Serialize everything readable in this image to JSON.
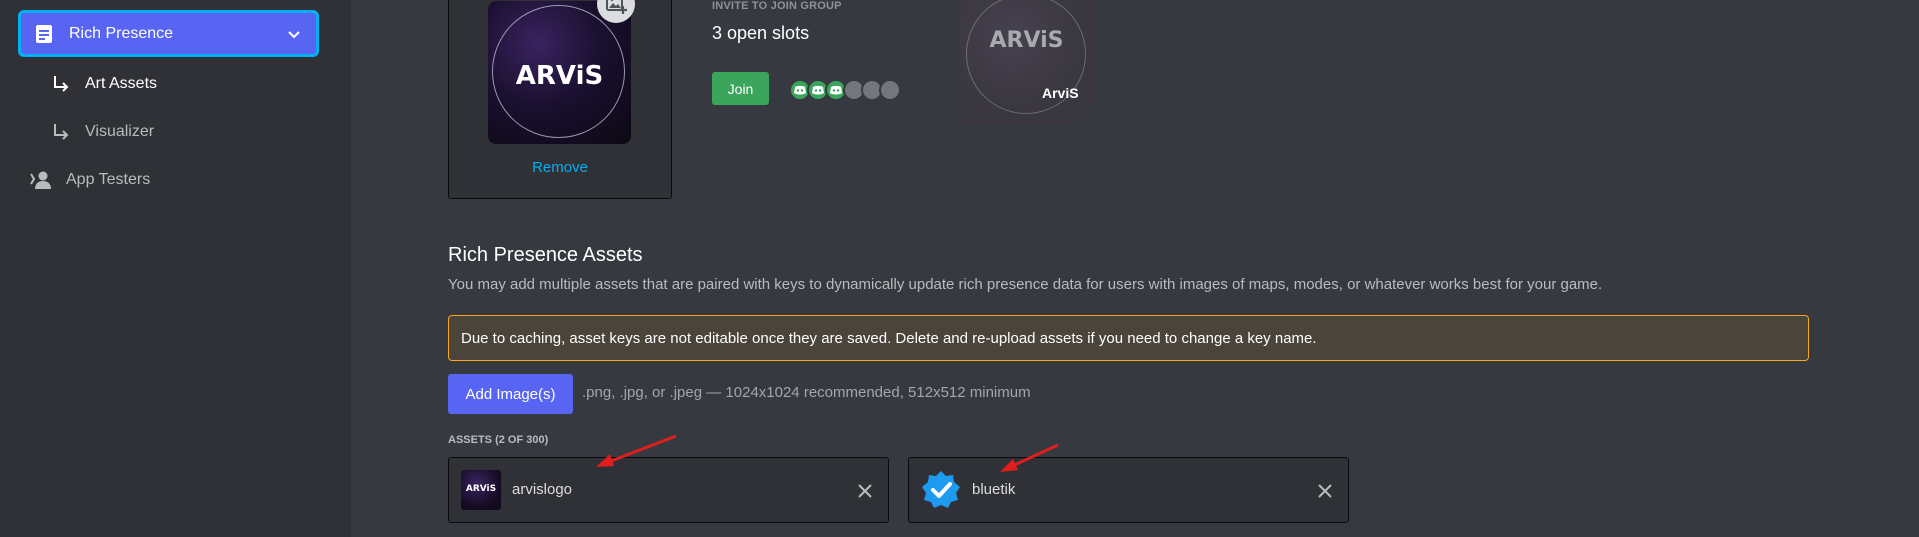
{
  "colors": {
    "accent": "#5865f2",
    "focus_ring": "#00b0f4",
    "join_green": "#3ba55c",
    "link": "#00aff4",
    "warning_border": "#faa81a",
    "annotation_red": "#e01e1e"
  },
  "sidebar": {
    "active_item": {
      "label": "Rich Presence",
      "icon": "document-icon",
      "expand_icon": "chevron-down-icon"
    },
    "sub_items": [
      {
        "label": "Art Assets",
        "icon": "subitem-arrow-icon"
      },
      {
        "label": "Visualizer",
        "icon": "subitem-arrow-icon"
      }
    ],
    "items": [
      {
        "label": "App Testers",
        "icon": "user-icon"
      }
    ]
  },
  "cover_preview": {
    "logo_text": "ARViS",
    "remove_label": "Remove",
    "upload_icon": "image-add-icon"
  },
  "invite_preview": {
    "heading": "INVITE TO JOIN GROUP",
    "slots_text": "3 open slots",
    "join_label": "Join",
    "party_filled": 3,
    "party_total": 6,
    "party_icon": "discord-logo-icon",
    "large_image_logo": "ARViS",
    "large_image_name": "ArviS"
  },
  "assets_section": {
    "title": "Rich Presence Assets",
    "description": "You may add multiple assets that are paired with keys to dynamically update rich presence data for users with images of maps, modes, or whatever works best for your game.",
    "warning": "Due to caching, asset keys are not editable once they are saved. Delete and re-upload assets if you need to change a key name.",
    "add_button": "Add Image(s)",
    "upload_hint": ".png, .jpg, or .jpeg — 1024x1024 recommended, 512x512 minimum",
    "count_label": "ASSETS (2 OF 300)",
    "assets": [
      {
        "name": "arvislogo",
        "thumb_text": "ARViS",
        "delete_icon": "close-icon"
      },
      {
        "name": "bluetik",
        "thumb_icon": "verified-check-icon",
        "delete_icon": "close-icon"
      }
    ]
  }
}
